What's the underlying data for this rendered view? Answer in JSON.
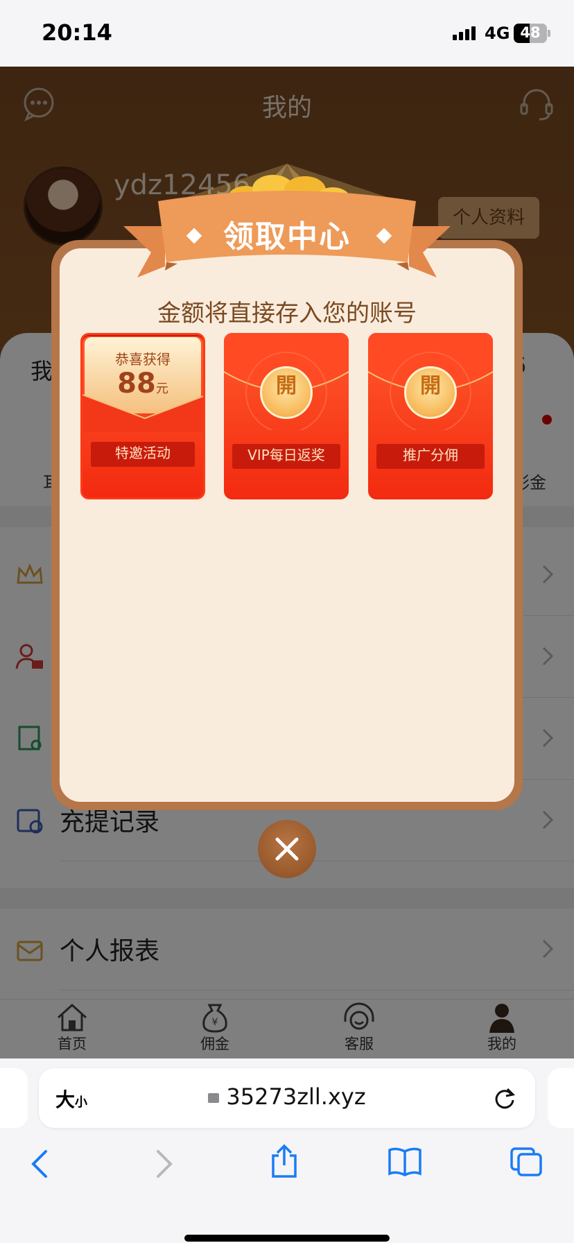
{
  "status_bar": {
    "time": "20:14",
    "network": "4G",
    "battery": "48",
    "battery_level": 0.48
  },
  "header": {
    "title": "我的",
    "username": "ydz12456",
    "profile_button": "个人资料",
    "chat_icon": "chat-bubble-icon",
    "support_icon": "headset-icon"
  },
  "background": {
    "partial_left": "我",
    "partial_right": "6",
    "partial_label_left": "耳",
    "partial_label_right": "彩金",
    "menu": [
      {
        "label": "",
        "icon": "crown-icon"
      },
      {
        "label": "",
        "icon": "user-card-icon"
      },
      {
        "label": "",
        "icon": "search-doc-icon"
      },
      {
        "label": "充提记录",
        "icon": "record-icon"
      },
      {
        "label": "个人报表",
        "icon": "report-icon"
      }
    ]
  },
  "tabbar": {
    "items": [
      {
        "label": "首页",
        "icon": "home-icon"
      },
      {
        "label": "佣金",
        "icon": "money-bag-icon"
      },
      {
        "label": "客服",
        "icon": "headset-icon"
      },
      {
        "label": "我的",
        "icon": "user-icon"
      }
    ]
  },
  "modal": {
    "title": "领取中心",
    "subtitle": "金额将直接存入您的账号",
    "envelopes": [
      {
        "state": "opened",
        "congrats": "恭喜获得",
        "amount": "88",
        "unit": "元",
        "label": "特邀活动"
      },
      {
        "state": "closed",
        "open_glyph": "開",
        "label": "VIP每日返奖"
      },
      {
        "state": "closed",
        "open_glyph": "開",
        "label": "推广分佣"
      }
    ]
  },
  "safari": {
    "text_size_label": "大",
    "text_size_small": "小",
    "url": "35273zll.xyz"
  }
}
